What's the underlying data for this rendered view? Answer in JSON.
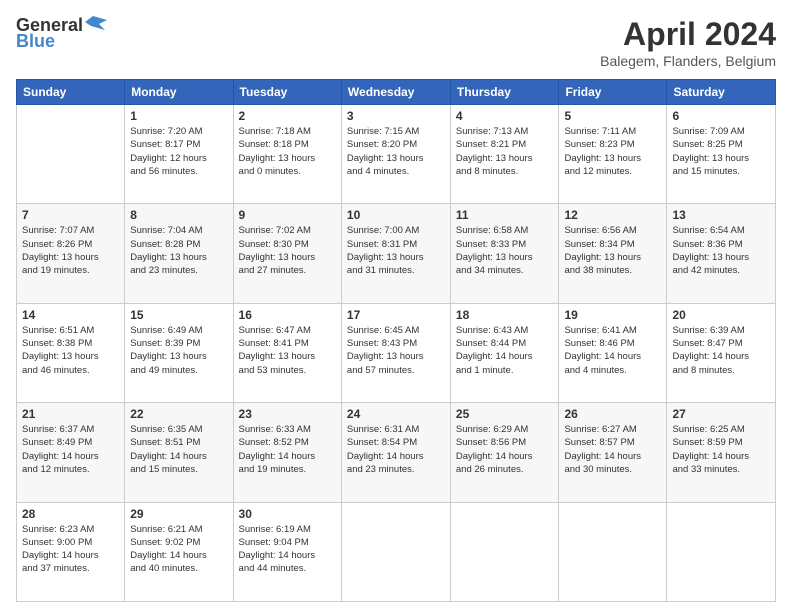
{
  "logo": {
    "general": "General",
    "blue": "Blue"
  },
  "header": {
    "month_year": "April 2024",
    "location": "Balegem, Flanders, Belgium"
  },
  "weekdays": [
    "Sunday",
    "Monday",
    "Tuesday",
    "Wednesday",
    "Thursday",
    "Friday",
    "Saturday"
  ],
  "weeks": [
    [
      {
        "day": "",
        "info": ""
      },
      {
        "day": "1",
        "info": "Sunrise: 7:20 AM\nSunset: 8:17 PM\nDaylight: 12 hours\nand 56 minutes."
      },
      {
        "day": "2",
        "info": "Sunrise: 7:18 AM\nSunset: 8:18 PM\nDaylight: 13 hours\nand 0 minutes."
      },
      {
        "day": "3",
        "info": "Sunrise: 7:15 AM\nSunset: 8:20 PM\nDaylight: 13 hours\nand 4 minutes."
      },
      {
        "day": "4",
        "info": "Sunrise: 7:13 AM\nSunset: 8:21 PM\nDaylight: 13 hours\nand 8 minutes."
      },
      {
        "day": "5",
        "info": "Sunrise: 7:11 AM\nSunset: 8:23 PM\nDaylight: 13 hours\nand 12 minutes."
      },
      {
        "day": "6",
        "info": "Sunrise: 7:09 AM\nSunset: 8:25 PM\nDaylight: 13 hours\nand 15 minutes."
      }
    ],
    [
      {
        "day": "7",
        "info": "Sunrise: 7:07 AM\nSunset: 8:26 PM\nDaylight: 13 hours\nand 19 minutes."
      },
      {
        "day": "8",
        "info": "Sunrise: 7:04 AM\nSunset: 8:28 PM\nDaylight: 13 hours\nand 23 minutes."
      },
      {
        "day": "9",
        "info": "Sunrise: 7:02 AM\nSunset: 8:30 PM\nDaylight: 13 hours\nand 27 minutes."
      },
      {
        "day": "10",
        "info": "Sunrise: 7:00 AM\nSunset: 8:31 PM\nDaylight: 13 hours\nand 31 minutes."
      },
      {
        "day": "11",
        "info": "Sunrise: 6:58 AM\nSunset: 8:33 PM\nDaylight: 13 hours\nand 34 minutes."
      },
      {
        "day": "12",
        "info": "Sunrise: 6:56 AM\nSunset: 8:34 PM\nDaylight: 13 hours\nand 38 minutes."
      },
      {
        "day": "13",
        "info": "Sunrise: 6:54 AM\nSunset: 8:36 PM\nDaylight: 13 hours\nand 42 minutes."
      }
    ],
    [
      {
        "day": "14",
        "info": "Sunrise: 6:51 AM\nSunset: 8:38 PM\nDaylight: 13 hours\nand 46 minutes."
      },
      {
        "day": "15",
        "info": "Sunrise: 6:49 AM\nSunset: 8:39 PM\nDaylight: 13 hours\nand 49 minutes."
      },
      {
        "day": "16",
        "info": "Sunrise: 6:47 AM\nSunset: 8:41 PM\nDaylight: 13 hours\nand 53 minutes."
      },
      {
        "day": "17",
        "info": "Sunrise: 6:45 AM\nSunset: 8:43 PM\nDaylight: 13 hours\nand 57 minutes."
      },
      {
        "day": "18",
        "info": "Sunrise: 6:43 AM\nSunset: 8:44 PM\nDaylight: 14 hours\nand 1 minute."
      },
      {
        "day": "19",
        "info": "Sunrise: 6:41 AM\nSunset: 8:46 PM\nDaylight: 14 hours\nand 4 minutes."
      },
      {
        "day": "20",
        "info": "Sunrise: 6:39 AM\nSunset: 8:47 PM\nDaylight: 14 hours\nand 8 minutes."
      }
    ],
    [
      {
        "day": "21",
        "info": "Sunrise: 6:37 AM\nSunset: 8:49 PM\nDaylight: 14 hours\nand 12 minutes."
      },
      {
        "day": "22",
        "info": "Sunrise: 6:35 AM\nSunset: 8:51 PM\nDaylight: 14 hours\nand 15 minutes."
      },
      {
        "day": "23",
        "info": "Sunrise: 6:33 AM\nSunset: 8:52 PM\nDaylight: 14 hours\nand 19 minutes."
      },
      {
        "day": "24",
        "info": "Sunrise: 6:31 AM\nSunset: 8:54 PM\nDaylight: 14 hours\nand 23 minutes."
      },
      {
        "day": "25",
        "info": "Sunrise: 6:29 AM\nSunset: 8:56 PM\nDaylight: 14 hours\nand 26 minutes."
      },
      {
        "day": "26",
        "info": "Sunrise: 6:27 AM\nSunset: 8:57 PM\nDaylight: 14 hours\nand 30 minutes."
      },
      {
        "day": "27",
        "info": "Sunrise: 6:25 AM\nSunset: 8:59 PM\nDaylight: 14 hours\nand 33 minutes."
      }
    ],
    [
      {
        "day": "28",
        "info": "Sunrise: 6:23 AM\nSunset: 9:00 PM\nDaylight: 14 hours\nand 37 minutes."
      },
      {
        "day": "29",
        "info": "Sunrise: 6:21 AM\nSunset: 9:02 PM\nDaylight: 14 hours\nand 40 minutes."
      },
      {
        "day": "30",
        "info": "Sunrise: 6:19 AM\nSunset: 9:04 PM\nDaylight: 14 hours\nand 44 minutes."
      },
      {
        "day": "",
        "info": ""
      },
      {
        "day": "",
        "info": ""
      },
      {
        "day": "",
        "info": ""
      },
      {
        "day": "",
        "info": ""
      }
    ]
  ]
}
